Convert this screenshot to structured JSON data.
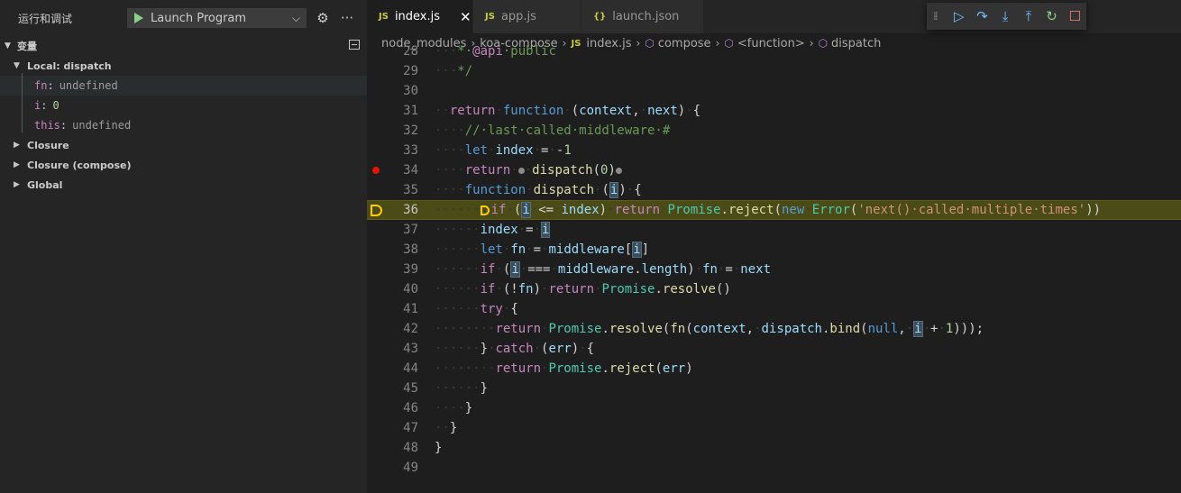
{
  "sidebar": {
    "title": "运行和调试",
    "launch_config": "Launch Program",
    "variables_header": "变量",
    "scopes": [
      {
        "label": "Local: dispatch",
        "expanded": true
      },
      {
        "label": "Closure",
        "expanded": false
      },
      {
        "label": "Closure (compose)",
        "expanded": false
      },
      {
        "label": "Global",
        "expanded": false
      }
    ],
    "locals": [
      {
        "name": "fn",
        "value": "undefined"
      },
      {
        "name": "i",
        "value": "0"
      },
      {
        "name": "this",
        "value": "undefined"
      }
    ]
  },
  "tabs": [
    {
      "label": "index.js",
      "icon": "JS",
      "active": true
    },
    {
      "label": "app.js",
      "icon": "JS",
      "active": false
    },
    {
      "label": "launch.json",
      "icon": "{}",
      "active": false
    }
  ],
  "debug_toolbar": [
    "continue-icon",
    "step-over-icon",
    "step-into-icon",
    "step-out-icon",
    "restart-icon",
    "stop-icon"
  ],
  "breadcrumb": {
    "parts": [
      "node_modules",
      "koa-compose",
      "index.js",
      "compose",
      "<function>",
      "dispatch"
    ]
  },
  "editor": {
    "current_line": 36,
    "breakpoint_lines": [
      34
    ],
    "line_numbers": [
      "28",
      "29",
      "30",
      "31",
      "32",
      "33",
      "34",
      "35",
      "36",
      "37",
      "38",
      "39",
      "40",
      "41",
      "42",
      "43",
      "44",
      "45",
      "46",
      "47",
      "48",
      "49"
    ]
  },
  "colors": {
    "current_line_bg": "#4b4b18",
    "breakpoint": "#e51400",
    "debug_arrow": "#ffcc00"
  }
}
